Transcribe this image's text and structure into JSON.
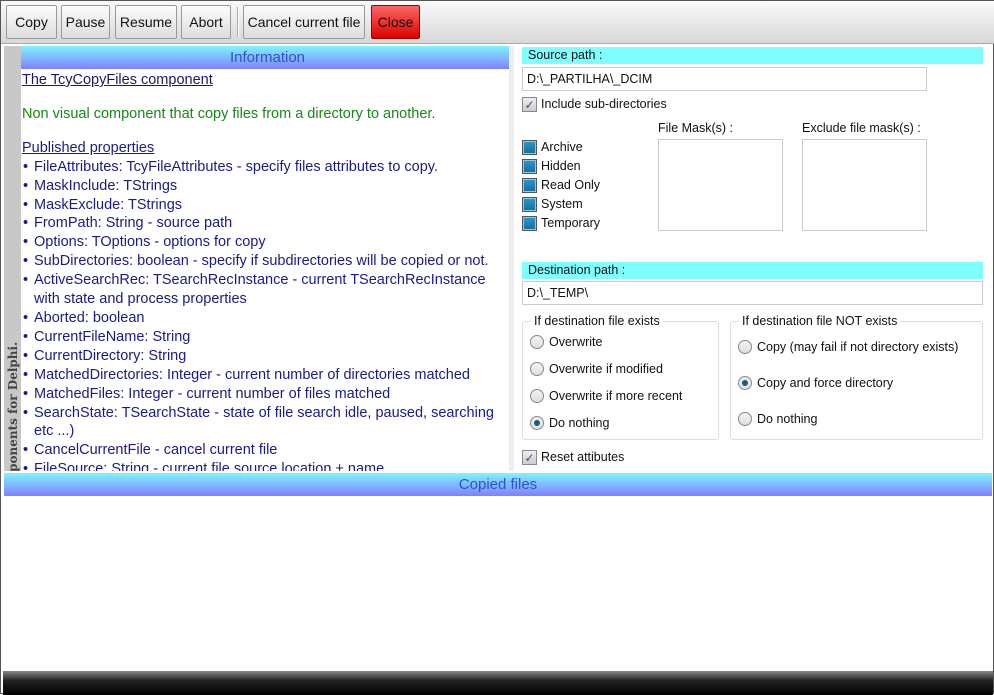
{
  "toolbar": {
    "buttons": [
      "Copy",
      "Pause",
      "Resume",
      "Abort",
      "Cancel current file",
      "Close"
    ]
  },
  "side_label": "Free TcyComponents for Delphi.",
  "info": {
    "header": "Information",
    "title": "The TcyCopyFiles component",
    "description": "Non visual component that copy files from a directory to another.",
    "published_header": "Published properties",
    "properties": [
      "FileAttributes: TcyFileAttributes - specify files attributes to copy.",
      "MaskInclude: TStrings",
      "MaskExclude: TStrings",
      "FromPath: String - source path",
      "Options: TOptions - options for copy",
      "SubDirectories: boolean - specify if subdirectories will be copied or not.",
      "ActiveSearchRec: TSearchRecInstance - current TSearchRecInstance with state and process properties",
      "Aborted: boolean",
      "CurrentFileName: String",
      "CurrentDirectory: String",
      "MatchedDirectories: Integer - current number of directories matched",
      "MatchedFiles: Integer  - current number of files matched",
      "SearchState: TSearchState - state of file search idle, paused, searching etc ...)",
      "CancelCurrentFile - cancel current file",
      "FileSource: String - current file source location + name"
    ]
  },
  "source": {
    "label": "Source path :",
    "value": "D:\\_PARTILHA\\_DCIM",
    "include_sub": "Include sub-directories",
    "attributes": [
      "Archive",
      "Hidden",
      "Read Only",
      "System",
      "Temporary"
    ],
    "file_mask_label": "File Mask(s) :",
    "exclude_mask_label": "Exclude file mask(s) :"
  },
  "destination": {
    "label": "Destination path :",
    "value": "D:\\_TEMP\\"
  },
  "exists_group": {
    "title": "If destination file exists",
    "options": [
      "Overwrite",
      "Overwrite if modified",
      "Overwrite if more recent",
      "Do nothing"
    ],
    "selected": 3
  },
  "not_exists_group": {
    "title": "If destination file NOT exists",
    "options": [
      "Copy (may fail if not directory exists)",
      "Copy and force directory",
      "Do nothing"
    ],
    "selected": 1
  },
  "reset_attributes": "Reset attibutes",
  "copied_header": "Copied files"
}
